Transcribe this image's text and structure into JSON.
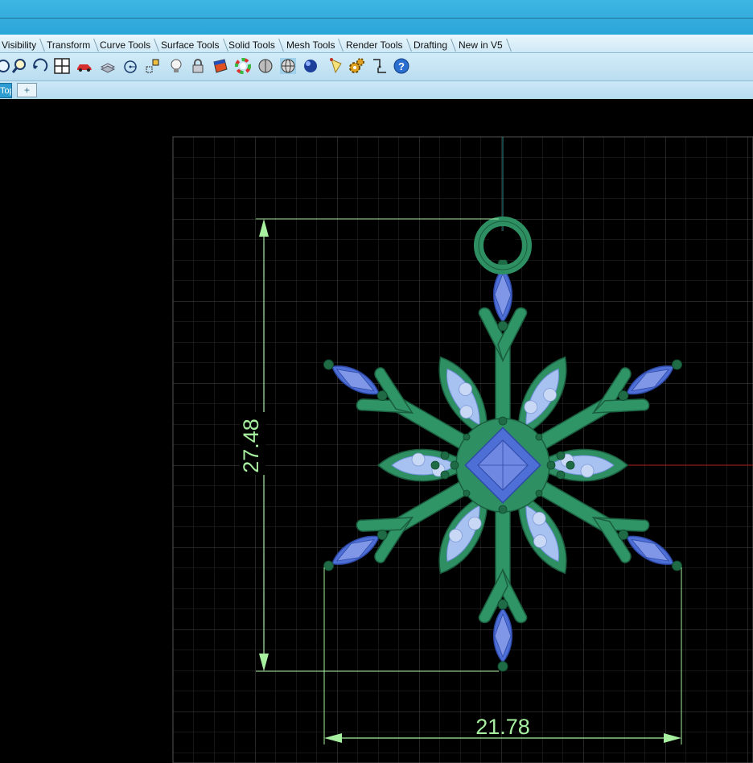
{
  "toolbar_tabs": [
    "Visibility",
    "Transform",
    "Curve Tools",
    "Surface Tools",
    "Solid Tools",
    "Mesh Tools",
    "Render Tools",
    "Drafting",
    "New in V5"
  ],
  "toolbar_icons": [
    "zoom-extents-icon",
    "zoom-window-icon",
    "rotate-view-icon",
    "four-viewports-icon",
    "car-render-icon",
    "layer-icon",
    "circle-tool-icon",
    "move-gumball-icon",
    "light-bulb-icon",
    "lock-icon",
    "material-icon",
    "color-wheel-icon",
    "shaded-sphere-icon",
    "ghosted-sphere-icon",
    "rendered-sphere-icon",
    "spotlight-icon",
    "settings-gears-icon",
    "snap-icon",
    "help-icon"
  ],
  "viewport_tabs": {
    "active_label": "Top",
    "add_symbol": "+"
  },
  "dimensions": {
    "height_value": "27.48",
    "width_value": "21.78"
  },
  "colors": {
    "dimension": "#a6f0a0",
    "pendant_metal": "#2e8f63",
    "gem": "#4f6fd8",
    "grid": "#3a3a3a",
    "x_axis": "#b02020",
    "y_axis": "#2a8a8a"
  }
}
